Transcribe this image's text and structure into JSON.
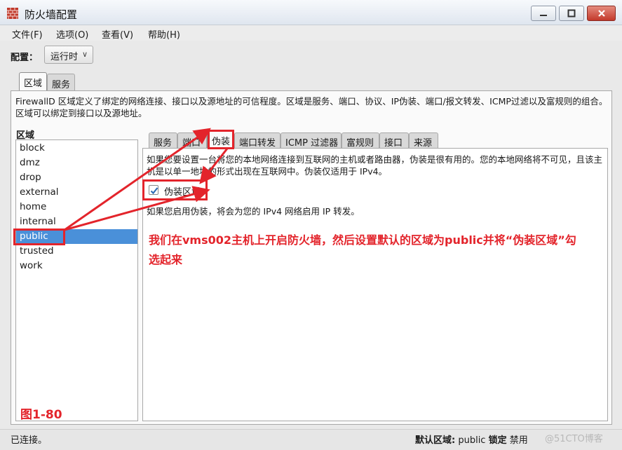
{
  "window": {
    "title": "防火墙配置"
  },
  "menu": [
    "文件(F)",
    "选项(O)",
    "查看(V)",
    "帮助(H)"
  ],
  "config": {
    "label": "配置：",
    "value": "运行时"
  },
  "top_tabs": [
    "区域",
    "服务"
  ],
  "zones_description": "FirewallD 区域定义了绑定的网络连接、接口以及源地址的可信程度。区域是服务、端口、协议、IP伪装、端口/报文转发、ICMP过滤以及富规则的组合。区域可以绑定到接口以及源地址。",
  "zones_label": "区域",
  "zones": [
    "block",
    "dmz",
    "drop",
    "external",
    "home",
    "internal",
    "public",
    "trusted",
    "work"
  ],
  "selected_zone": "public",
  "inner_tabs": [
    "服务",
    "端口",
    "伪装",
    "端口转发",
    "ICMP 过滤器",
    "富规则",
    "接口",
    "来源"
  ],
  "active_inner_tab": "伪装",
  "masquerade": {
    "description": "如果您要设置一台将您的本地网络连接到互联网的主机或者路由器，伪装是很有用的。您的本地网络将不可见，且该主机是以单一地址的形式出现在互联网中。伪装仅适用于 IPv4。",
    "checkbox_label": "伪装区域",
    "checked": true,
    "note": "如果您启用伪装，将会为您的 IPv4 网络启用 IP 转发。"
  },
  "annotation": "我们在vms002主机上开启防火墙，然后设置默认的区域为public并将“伪装区域”勾选起来",
  "figure_label": "图1-80",
  "status": {
    "left": "已连接。",
    "default_zone_label": "默认区域:",
    "default_zone_value": "public",
    "lock_label": "锁定",
    "lock_value": "禁用",
    "watermark": "@51CTO博客"
  },
  "colors": {
    "annotation_red": "#e3242b",
    "selection_blue": "#4a90d9"
  },
  "icons": {
    "app": "firewall-icon",
    "check": "check-icon"
  }
}
